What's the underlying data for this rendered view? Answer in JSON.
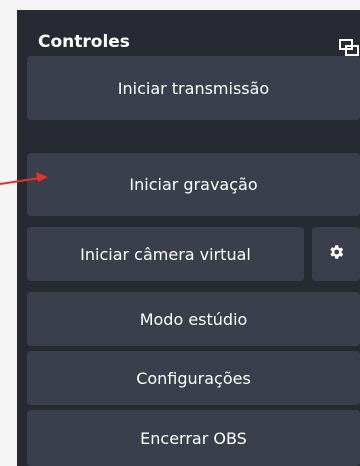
{
  "panel": {
    "title": "Controles",
    "buttons": {
      "start_stream": "Iniciar transmissão",
      "start_recording": "Iniciar gravação",
      "start_virtual_camera": "Iniciar câmera virtual",
      "studio_mode": "Modo estúdio",
      "settings": "Configurações",
      "exit": "Encerrar OBS"
    },
    "icons": {
      "dock": "undock-icon",
      "virtual_camera_settings": "gear-icon"
    }
  },
  "annotation": {
    "arrow_icon": "red-arrow-icon",
    "arrow_color": "#e8312a"
  },
  "colors": {
    "panel_bg": "#272a33",
    "button_bg": "#3b3f4b",
    "text": "#ffffff"
  }
}
